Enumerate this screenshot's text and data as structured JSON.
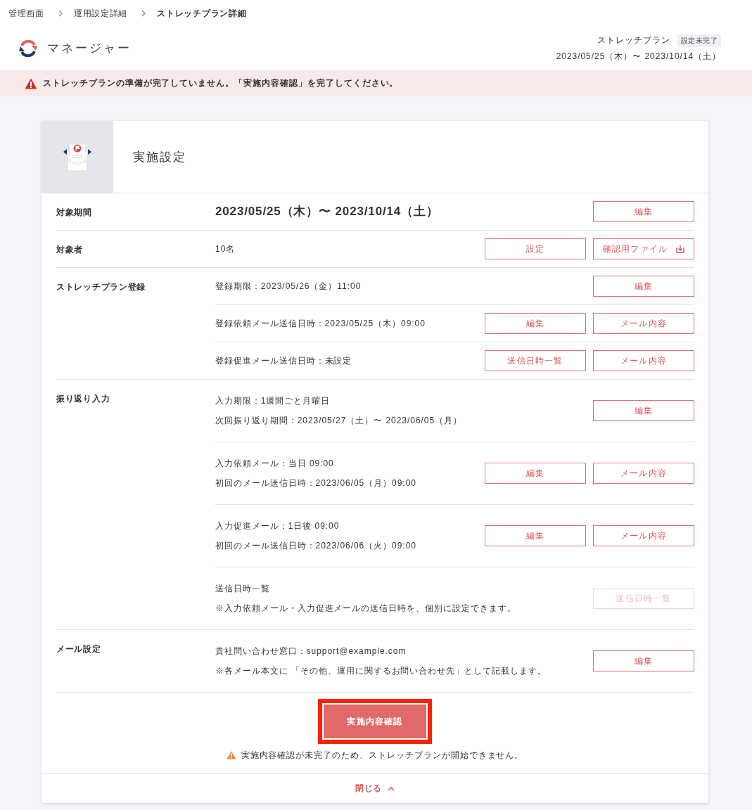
{
  "breadcrumbs": [
    {
      "label": "管理画面",
      "current": false
    },
    {
      "label": "運用設定詳細",
      "current": false
    },
    {
      "label": "ストレッチプラン詳細",
      "current": true
    }
  ],
  "header": {
    "app_name": "マネージャー",
    "plan_name": "ストレッチプラン",
    "status_badge": "設定未完了",
    "period": "2023/05/25（木）〜 2023/10/14（土）"
  },
  "alert": {
    "message": "ストレッチプランの準備が完了していません。「実施内容確認」を完了してください。"
  },
  "card": {
    "title": "実施設定",
    "sections": [
      {
        "label": "対象期間",
        "rows": [
          {
            "kind": "large",
            "lines": [
              "2023/05/25（木）〜 2023/10/14（土）"
            ],
            "buttons": [
              {
                "label": "編集",
                "kind": "plain",
                "disabled": false
              }
            ]
          }
        ]
      },
      {
        "label": "対象者",
        "rows": [
          {
            "kind": "normal",
            "lines": [
              "10名"
            ],
            "buttons": [
              {
                "label": "設定",
                "kind": "plain",
                "disabled": false
              },
              {
                "label": "確認用ファイル",
                "kind": "with_icon",
                "disabled": false
              }
            ]
          }
        ]
      },
      {
        "label": "ストレッチプラン登録",
        "rows": [
          {
            "kind": "normal",
            "lines": [
              "登録期限：2023/05/26（金）11:00"
            ],
            "buttons": [
              {
                "label": "編集",
                "kind": "plain",
                "disabled": false
              }
            ]
          },
          {
            "kind": "normal",
            "lines": [
              "登録依頼メール送信日時：2023/05/25（木）09:00"
            ],
            "buttons": [
              {
                "label": "編集",
                "kind": "plain",
                "disabled": false
              },
              {
                "label": "メール内容",
                "kind": "plain",
                "disabled": false
              }
            ]
          },
          {
            "kind": "normal",
            "lines": [
              "登録促進メール送信日時：未設定"
            ],
            "buttons": [
              {
                "label": "送信日時一覧",
                "kind": "plain",
                "disabled": false
              },
              {
                "label": "メール内容",
                "kind": "plain",
                "disabled": false
              }
            ]
          }
        ]
      },
      {
        "label": "振り返り入力",
        "rows": [
          {
            "kind": "normal",
            "lines": [
              "入力期限：1週間ごと月曜日",
              "次回振り返り期間：2023/05/27（土）〜 2023/06/05（月）"
            ],
            "buttons": [
              {
                "label": "編集",
                "kind": "plain",
                "disabled": false
              }
            ]
          },
          {
            "kind": "normal",
            "lines": [
              "入力依頼メール：当日 09:00",
              "初回のメール送信日時：2023/06/05（月）09:00"
            ],
            "buttons": [
              {
                "label": "編集",
                "kind": "plain",
                "disabled": false
              },
              {
                "label": "メール内容",
                "kind": "plain",
                "disabled": false
              }
            ]
          },
          {
            "kind": "normal",
            "lines": [
              "入力促進メール：1日後 09:00",
              "初回のメール送信日時：2023/06/06（火）09:00"
            ],
            "buttons": [
              {
                "label": "編集",
                "kind": "plain",
                "disabled": false
              },
              {
                "label": "メール内容",
                "kind": "plain",
                "disabled": false
              }
            ]
          },
          {
            "kind": "normal",
            "lines": [
              "送信日時一覧",
              "※入力依頼メール・入力促進メールの送信日時を、個別に設定できます。"
            ],
            "buttons": [
              {
                "label": "送信日時一覧",
                "kind": "plain",
                "disabled": true
              }
            ]
          }
        ]
      },
      {
        "label": "メール設定",
        "rows": [
          {
            "kind": "normal",
            "lines": [
              "貴社問い合わせ窓口：support@example.com",
              "※各メール本文に 「その他、運用に関するお問い合わせ先」として記載します。"
            ],
            "buttons": [
              {
                "label": "編集",
                "kind": "plain",
                "disabled": false
              }
            ]
          }
        ]
      }
    ],
    "confirm_button": {
      "label": "実施内容確認",
      "highlighted": true
    },
    "warning": "実施内容確認が未完了のため、ストレッチプランが開始できません。",
    "close_link": "閉じる"
  }
}
